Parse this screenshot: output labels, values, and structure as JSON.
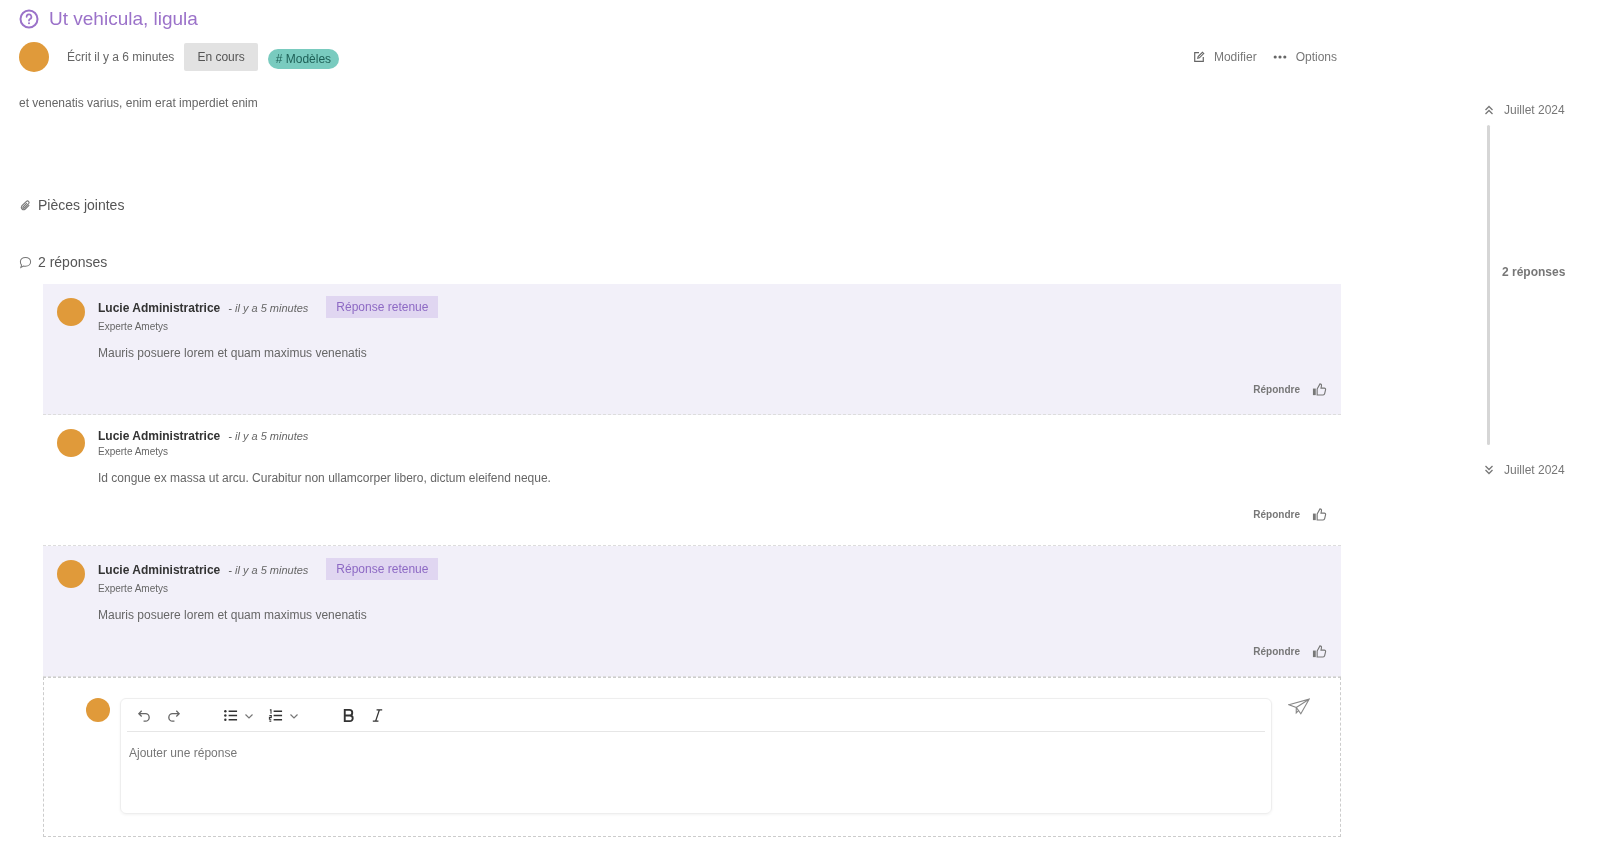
{
  "question": {
    "title": "Ut vehicula, ligula",
    "written": "Écrit il y a 6 minutes",
    "status": "En cours",
    "tag": "Modèles",
    "tag_symbol": "#",
    "body": "et venenatis varius, enim erat imperdiet enim"
  },
  "actions": [
    "Modifier",
    "Options"
  ],
  "attachments": {
    "label": "Pièces jointes"
  },
  "responses_count": "2 réponses",
  "replies": [
    {
      "author": "Lucie Administratrice",
      "time": "- il y a 5 minutes",
      "role": "Experte Ametys",
      "accepted": true,
      "badge": "Réponse retenue",
      "text": "Mauris posuere lorem et quam maximus venenatis",
      "reply": "Répondre"
    },
    {
      "author": "Lucie Administratrice",
      "time": "- il y a 5 minutes",
      "role": "Experte Ametys",
      "accepted": false,
      "text": "Id congue ex massa ut arcu. Curabitur non ullamcorper libero, dictum eleifend neque.",
      "reply": "Répondre"
    },
    {
      "author": "Lucie Administratrice",
      "time": "- il y a 5 minutes",
      "role": "Experte Ametys",
      "accepted": true,
      "badge": "Réponse retenue",
      "text": "Mauris posuere lorem et quam maximus venenatis",
      "reply": "Répondre"
    }
  ],
  "editor": {
    "placeholder": "Ajouter une réponse"
  },
  "timeline": {
    "start": "Juillet 2024",
    "middle": "2 réponses",
    "end": "Juillet 2024"
  }
}
